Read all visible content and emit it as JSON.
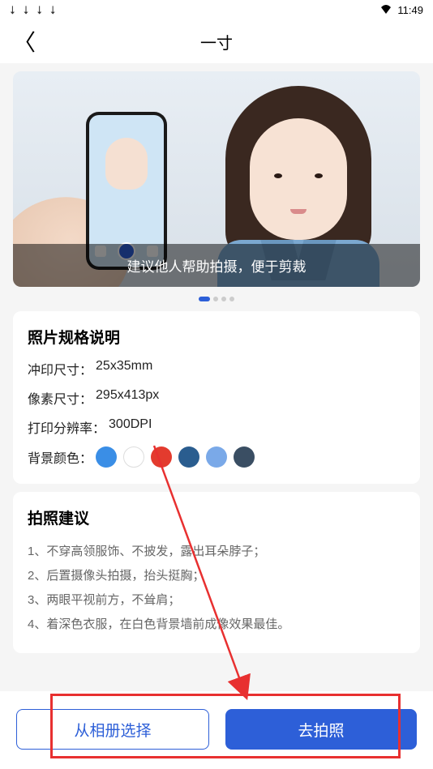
{
  "status": {
    "time": "11:49"
  },
  "header": {
    "title": "一寸"
  },
  "banner": {
    "caption": "建议他人帮助拍摄，便于剪裁"
  },
  "spec": {
    "title": "照片规格说明",
    "print_size_label": "冲印尺寸：",
    "print_size_value": "25x35mm",
    "pixel_size_label": "像素尺寸：",
    "pixel_size_value": "295x413px",
    "dpi_label": "打印分辨率：",
    "dpi_value": "300DPI",
    "bg_color_label": "背景颜色：",
    "colors": [
      "#3a8ee6",
      "#ffffff",
      "#e33b2e",
      "#2a5d8f",
      "#7aa9e8",
      "#3a4e63"
    ]
  },
  "tips": {
    "title": "拍照建议",
    "items": [
      "1、不穿高领服饰、不披发，露出耳朵脖子；",
      "2、后置摄像头拍摄，抬头挺胸；",
      "3、两眼平视前方，不耸肩；",
      "4、着深色衣服，在白色背景墙前成像效果最佳。"
    ]
  },
  "buttons": {
    "album": "从相册选择",
    "camera": "去拍照"
  }
}
